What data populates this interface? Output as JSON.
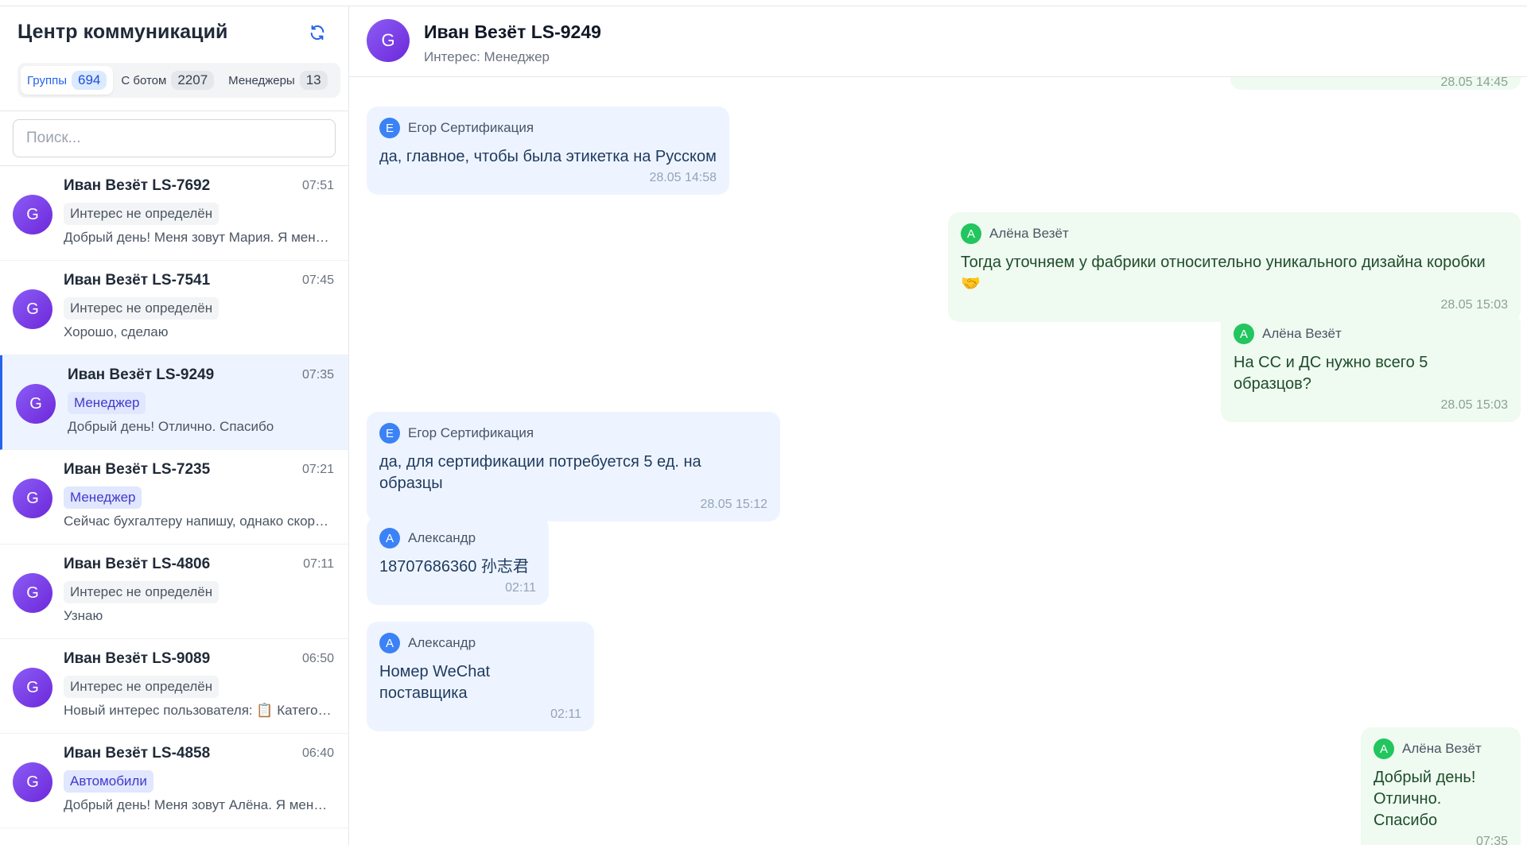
{
  "sidebar": {
    "title": "Центр коммуникаций",
    "tabs": [
      {
        "label": "Группы",
        "count": "694"
      },
      {
        "label": "С ботом",
        "count": "2207"
      },
      {
        "label": "Менеджеры",
        "count": "13"
      }
    ],
    "search_placeholder": "Поиск...",
    "chats": [
      {
        "avatar": "G",
        "name": "Иван Везёт LS-7692",
        "time": "07:51",
        "badge": "Интерес не определён",
        "preview": "Добрый день! Меня зовут Мария. Я менеджер"
      },
      {
        "avatar": "G",
        "name": "Иван Везёт LS-7541",
        "time": "07:45",
        "badge": "Интерес не определён",
        "preview": "Хорошо, сделаю"
      },
      {
        "avatar": "G",
        "name": "Иван Везёт LS-9249",
        "time": "07:35",
        "badge": "Менеджер",
        "preview": "Добрый день! Отлично. Спасибо"
      },
      {
        "avatar": "G",
        "name": "Иван Везёт LS-7235",
        "time": "07:21",
        "badge": "Менеджер",
        "preview": "Сейчас бухгалтеру напишу, однако скорее всего"
      },
      {
        "avatar": "G",
        "name": "Иван Везёт LS-4806",
        "time": "07:11",
        "badge": "Интерес не определён",
        "preview": "Узнаю"
      },
      {
        "avatar": "G",
        "name": "Иван Везёт LS-9089",
        "time": "06:50",
        "badge": "Интерес не определён",
        "preview": "Новый интерес пользователя: 📋 Категория"
      },
      {
        "avatar": "G",
        "name": "Иван Везёт LS-4858",
        "time": "06:40",
        "badge": "Автомобили",
        "preview": "Добрый день! Меня зовут Алёна. Я менеджер"
      }
    ]
  },
  "header": {
    "avatar": "G",
    "name": "Иван Везёт LS-9249",
    "subtitle": "Интерес: Менеджер"
  },
  "messages": [
    {
      "direction": "out",
      "avatar": "",
      "sender": "",
      "text": "",
      "time": "28.05 14:45"
    },
    {
      "direction": "in",
      "avatar": "Е",
      "sender": "Егор Сертификация",
      "text": "да, главное, чтобы была этикетка на Русском",
      "time": "28.05 14:58"
    },
    {
      "direction": "out",
      "avatar": "А",
      "sender": "Алёна Везёт",
      "text": "Тогда уточняем у фабрики относительно уникального дизайна коробки 🤝",
      "time": "28.05 15:03"
    },
    {
      "direction": "out",
      "avatar": "А",
      "sender": "Алёна Везёт",
      "text": "На СС и ДС нужно всего 5 образцов?",
      "time": "28.05 15:03"
    },
    {
      "direction": "in",
      "avatar": "Е",
      "sender": "Егор Сертификация",
      "text": "да, для сертификации потребуется 5 ед. на образцы",
      "time": "28.05 15:12"
    },
    {
      "direction": "in",
      "avatar": "А",
      "sender": "Александр",
      "text": "18707686360   孙志君",
      "time": "02:11"
    },
    {
      "direction": "in",
      "avatar": "А",
      "sender": "Александр",
      "text": "Номер WeChat поставщика",
      "time": "02:11"
    },
    {
      "direction": "out",
      "avatar": "А",
      "sender": "Алёна Везёт",
      "text": "Добрый день!\nОтлично. Спасибо",
      "time": "07:35"
    }
  ],
  "colors": {
    "accent": "#2563eb",
    "incoming_bubble": "#eef4ff",
    "outgoing_bubble": "#effaf1",
    "avatar_gradient": "#7c3aed"
  }
}
